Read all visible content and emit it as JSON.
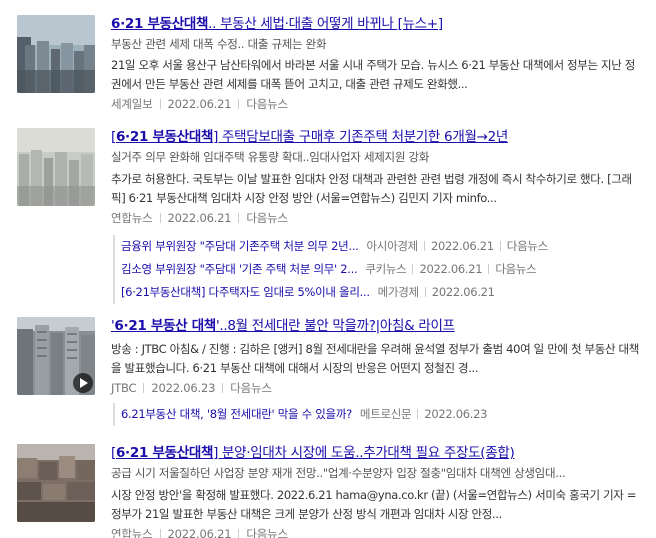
{
  "results": [
    {
      "title_pre": "",
      "title_bold": "6·21 부동산대책",
      "title_post": ".. 부동산 세법·대출 어떻게 바뀌나 [뉴스+]",
      "subtitle": "부동산 관련 세제 대폭 수정.. 대출 규제는 완화",
      "desc": "21일 오후 서울 용산구 남산타워에서 바라본 서울 시내 주택가 모습. 뉴시스 6·21 부동산 대책에서 정부는 지난 정권에서 만든 부동산 관련 세제를 대폭 뜯어 고치고, 대출 관련 규제도 완화했...",
      "source": "세계일보",
      "date": "2022.06.21",
      "link": "다음뉴스"
    },
    {
      "title_pre": "[",
      "title_bold": "6·21 부동산대책",
      "title_post": "] 주택담보대출 구매후 기존주택 처분기한 6개월→2년",
      "subtitle": "실거주 의무 완화해 임대주택 유통량 확대..임대사업자 세제지원 강화",
      "desc": "추가로 허용한다. 국토부는 이날 발표한 임대차 안정 대책과 관련한 관련 법령 개정에 즉시 착수하기로 했다. [그래픽] 6·21 부동산대책 임대차 시장 안정 방안 (서울=연합뉴스) 김민지 기자 minfo...",
      "source": "연합뉴스",
      "date": "2022.06.21",
      "link": "다음뉴스",
      "related": [
        {
          "text": "금융위 부위원장 \"주담대 기존주택 처분 의무 2년...",
          "source": "아시아경제",
          "date": "2022.06.21",
          "link": "다음뉴스"
        },
        {
          "text": "김소영 부위원장 \"주담대 '기존 주택 처분 의무' 2...",
          "source": "쿠키뉴스",
          "date": "2022.06.21",
          "link": "다음뉴스"
        },
        {
          "text": "[6·21부동산대책] 다주택자도 임대로 5%이내 올리...",
          "source": "메가경제",
          "date": "2022.06.21",
          "link": ""
        }
      ]
    },
    {
      "title_pre": "'",
      "title_bold": "6·21 부동산 대책",
      "title_post": "'..8월 전세대란 불안 막을까?|아침& 라이프",
      "subtitle": "",
      "desc": "방송 : JTBC 아침& / 진행 : 김하은 [앵커] 8월 전세대란을 우려해 윤석열 정부가 출범 40여 일 만에 첫 부동산 대책을 발표했습니다. 6·21 부동산 대책에 대해서 시장의 반응은 어떤지 정철진 경...",
      "source": "JTBC",
      "date": "2022.06.23",
      "link": "다음뉴스",
      "related": [
        {
          "text": "6.21부동산 대책, '8월 전세대란' 막을 수 있을까?",
          "source": "메트로신문",
          "date": "2022.06.23",
          "link": ""
        }
      ]
    },
    {
      "title_pre": "[",
      "title_bold": "6·21 부동산대책",
      "title_post": "] 분양·임대차 시장에 도움..추가대책 필요 주장도(종합)",
      "subtitle": "공급 시기 저울질하던 사업장 분양 재개 전망..\"업계·수분양자 입장 절충\"임대차 대책엔 상생임대...",
      "desc": "시장 안정 방안'을 확정해 발표했다. 2022.6.21 hama@yna.co.kr (끝) (서울=연합뉴스) 서미숙 홍국기 기자 = 정부가 21일 발표한 부동산 대책은 크게 분양가 산정 방식 개편과 임대차 시장 안정...",
      "source": "연합뉴스",
      "date": "2022.06.21",
      "link": "다음뉴스"
    }
  ],
  "icons": {
    "video": "play-icon"
  }
}
